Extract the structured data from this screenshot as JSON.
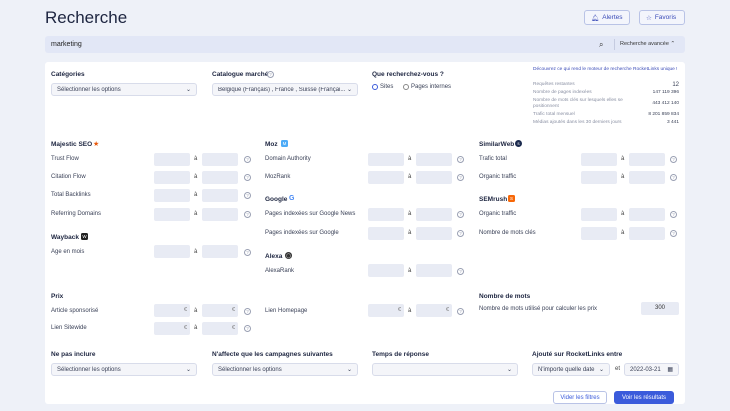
{
  "page": {
    "title": "Recherche"
  },
  "header": {
    "alerts_label": "Alertes",
    "favorites_label": "Favoris"
  },
  "search": {
    "value": "marketing",
    "advanced_label": "Recherche avancée"
  },
  "filters": {
    "categories_label": "Catégories",
    "categories_value": "Sélectionner les options",
    "catalogue_label": "Catalogue marché",
    "catalogue_value": "Belgique (Français) , France , Suisse (Françai...",
    "looking_label": "Que recherchez-vous ?",
    "radio_sites": "Sites",
    "radio_internal": "Pages internes"
  },
  "stats": {
    "link": "Découvrez ce qui rend le moteur de recherche RocketLinks unique !",
    "rows": [
      {
        "label": "Requêtes restantes",
        "value": "12"
      },
      {
        "label": "Nombre de pages indexées",
        "value": "147 119 396"
      },
      {
        "label": "Nombre de mots clés sur lesquels elles se positionnent",
        "value": "443 412 140"
      },
      {
        "label": "Trafic total mensuel",
        "value": "8 201 859 834"
      },
      {
        "label": "Médias ajoutés dans les 30 derniers jours",
        "value": "3 441"
      }
    ]
  },
  "a_label": "à",
  "majestic": {
    "title": "Majestic SEO",
    "rows": [
      "Trust Flow",
      "Citation Flow",
      "Total Backlinks",
      "Referring Domains"
    ]
  },
  "wayback": {
    "title": "Wayback",
    "rows": [
      "Age en mois"
    ]
  },
  "moz": {
    "title": "Moz",
    "rows": [
      "Domain Authority",
      "MozRank"
    ]
  },
  "google": {
    "title": "Google",
    "rows": [
      "Pages indexées sur Google News",
      "Pages indexées sur Google"
    ]
  },
  "alexa": {
    "title": "Alexa",
    "rows": [
      "AlexaRank"
    ]
  },
  "similarweb": {
    "title": "SimilarWeb",
    "rows": [
      "Trafic total",
      "Organic traffic"
    ]
  },
  "semrush": {
    "title": "SEMrush",
    "rows": [
      "Organic traffic",
      "Nombre de mots clés"
    ]
  },
  "prix": {
    "title": "Prix",
    "rows": [
      "Article sponsorisé",
      "Lien Sitewide"
    ],
    "lien_homepage": "Lien Homepage",
    "currency": "€"
  },
  "words": {
    "title": "Nombre de mots",
    "label": "Nombre de mots utilisé pour calculer les prix",
    "value": "300"
  },
  "bottom": {
    "exclude_label": "Ne pas inclure",
    "exclude_value": "Sélectionner les options",
    "campaigns_label": "N'affecte que les campagnes suivantes",
    "campaigns_value": "Sélectionner les options",
    "response_label": "Temps de réponse",
    "added_label": "Ajouté sur RocketLinks entre",
    "added_from": "N'importe quelle date",
    "et_label": "et",
    "added_to": "2022-03-21"
  },
  "actions": {
    "clear_label": "Vider les filtres",
    "results_label": "Voir les résultats"
  },
  "colors": {
    "accent": "#3b5bdb",
    "majestic": "#e8590c",
    "moz": "#4dabf7",
    "semrush": "#f76707"
  }
}
